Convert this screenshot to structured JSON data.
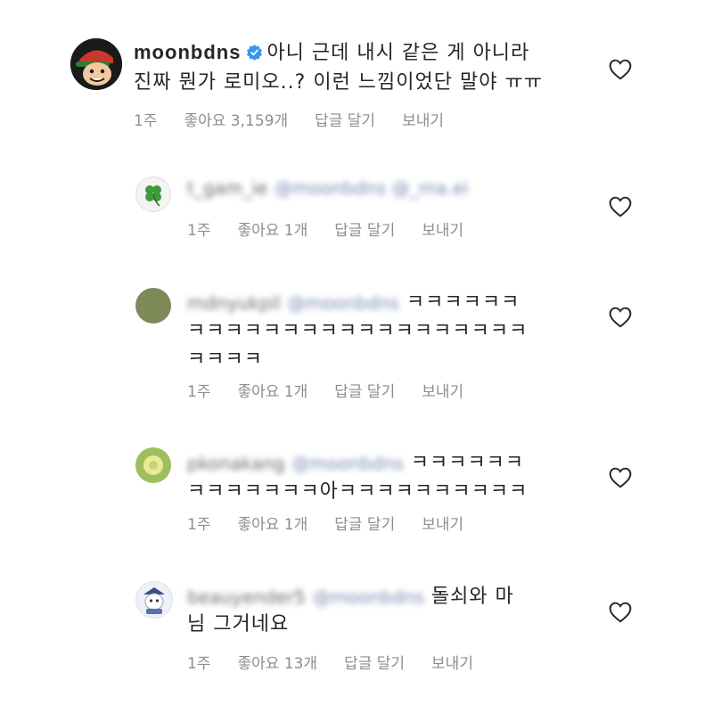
{
  "comments": [
    {
      "username": "moonbdns",
      "verified": true,
      "line1": "아니 근데 내시 같은 게 아니라",
      "line2": "진짜 뭔가 로미오..? 이런 느낌이었단 말야 ㅠㅠ",
      "time": "1주",
      "likes": "좋아요 3,159개",
      "reply": "답글 달기",
      "send": "보내기"
    },
    {
      "username": "t_gam_ie",
      "mention": "@moonbdns @_ma.ei",
      "time": "1주",
      "likes": "좋아요 1개",
      "reply": "답글 달기",
      "send": "보내기"
    },
    {
      "username": "mdnyukpil",
      "mention": "@moonbdns",
      "line1_tail": "ㅋㅋㅋㅋㅋㅋ",
      "line2": "ㅋㅋㅋㅋㅋㅋㅋㅋㅋㅋㅋㅋㅋㅋㅋㅋㅋㅋ",
      "line3": "ㅋㅋㅋㅋ",
      "time": "1주",
      "likes": "좋아요 1개",
      "reply": "답글 달기",
      "send": "보내기"
    },
    {
      "username": "pkonakang",
      "mention": "@moonbdns",
      "line1_tail": "ㅋㅋㅋㅋㅋㅋ",
      "line2": "ㅋㅋㅋㅋㅋㅋㅋ아ㅋㅋㅋㅋㅋㅋㅋㅋㅋㅋ",
      "time": "1주",
      "likes": "좋아요 1개",
      "reply": "답글 달기",
      "send": "보내기"
    },
    {
      "username": "beauyender5",
      "mention": "@moonbdns",
      "line1_tail": "돌쇠와 마",
      "line2": "님 그거네요",
      "time": "1주",
      "likes": "좋아요 13개",
      "reply": "답글 달기",
      "send": "보내기"
    }
  ],
  "icons": {
    "like": "heart-icon",
    "verified": "verified-badge-icon"
  },
  "colors": {
    "text": "#262626",
    "meta": "#8e8e8e",
    "verified": "#3897f0"
  }
}
